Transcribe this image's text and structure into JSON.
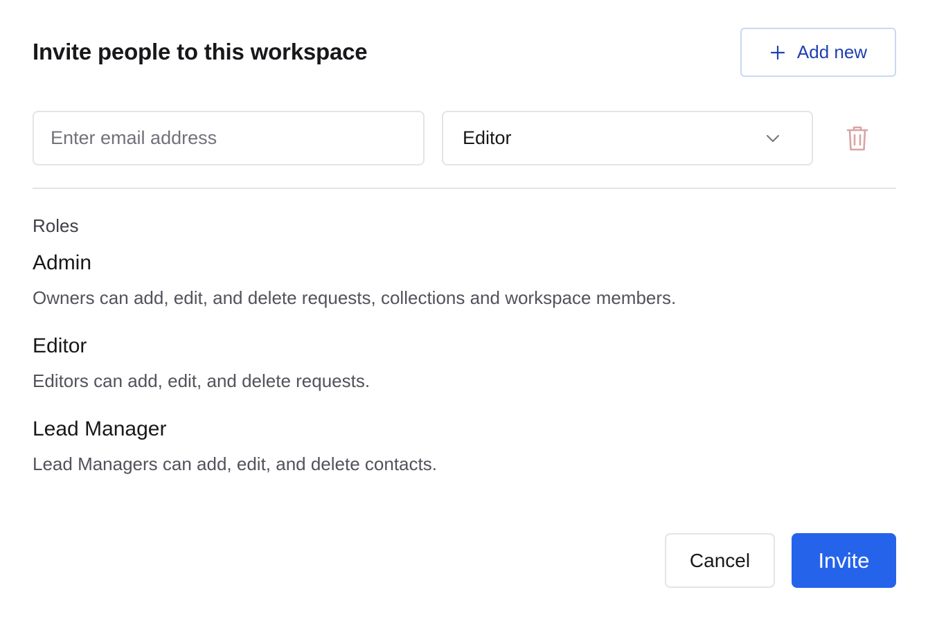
{
  "dialog": {
    "title": "Invite people to this workspace",
    "add_new_label": "Add new"
  },
  "invite_row": {
    "email_placeholder": "Enter email address",
    "email_value": "",
    "role_selected": "Editor",
    "icons": {
      "dropdown": "chevron-down-icon",
      "delete": "trash-icon"
    }
  },
  "roles": {
    "heading": "Roles",
    "items": [
      {
        "name": "Admin",
        "description": "Owners can add, edit, and delete requests, collections and workspace members."
      },
      {
        "name": "Editor",
        "description": "Editors can add, edit, and delete requests."
      },
      {
        "name": "Lead Manager",
        "description": "Lead Managers can add, edit, and delete contacts."
      }
    ]
  },
  "footer": {
    "cancel_label": "Cancel",
    "invite_label": "Invite"
  },
  "colors": {
    "primary": "#2563eb",
    "add_new_text": "#1e40af",
    "add_new_border": "#c7d9f3",
    "delete_icon": "#d9a3a3",
    "border": "#e4e4e7"
  }
}
